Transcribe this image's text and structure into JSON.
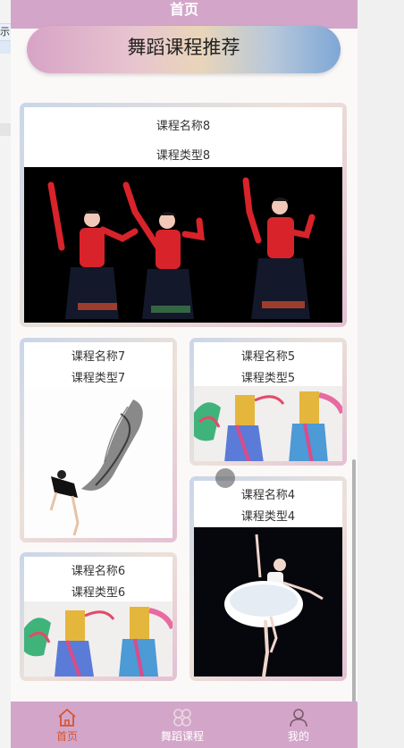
{
  "left_fragment_text": "示",
  "header": {
    "title": "首页"
  },
  "banner": {
    "title": "舞蹈课程推荐"
  },
  "courses": [
    {
      "name": "课程名称8",
      "type": "课程类型8",
      "image": "three-dancers-red-tops"
    },
    {
      "name": "课程名称7",
      "type": "课程类型7",
      "image": "dancer-black-veil"
    },
    {
      "name": "课程名称5",
      "type": "课程类型5",
      "image": "dunhuang-dancers"
    },
    {
      "name": "课程名称4",
      "type": "课程类型4",
      "image": "ballerina-white-tutu"
    },
    {
      "name": "课程名称6",
      "type": "课程类型6",
      "image": "dunhuang-dancers"
    }
  ],
  "tabbar": {
    "items": [
      {
        "label": "首页",
        "icon": "home-icon",
        "active": true
      },
      {
        "label": "舞蹈课程",
        "icon": "grid-icon",
        "active": false
      },
      {
        "label": "我的",
        "icon": "user-icon",
        "active": false
      }
    ]
  },
  "colors": {
    "theme": "#d3a6c9",
    "active_tab": "#d4552f"
  }
}
